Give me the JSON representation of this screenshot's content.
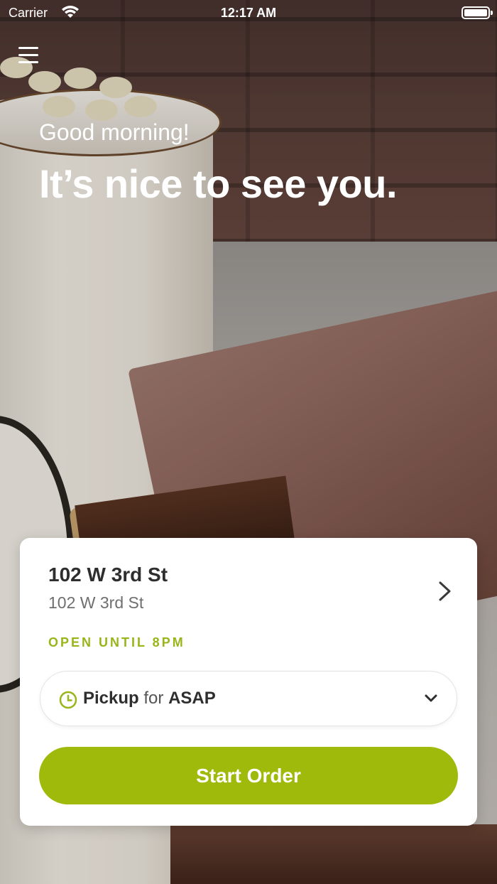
{
  "status_bar": {
    "carrier": "Carrier",
    "time": "12:17 AM"
  },
  "hero": {
    "greeting": "Good morning!",
    "headline": "It’s nice to see you."
  },
  "location_card": {
    "location_name": "102 W 3rd St",
    "location_address": "102 W 3rd St",
    "open_status": "OPEN UNTIL 8PM",
    "pickup": {
      "mode": "Pickup",
      "connector": "for",
      "time": "ASAP"
    },
    "start_order_label": "Start Order"
  },
  "colors": {
    "accent": "#9fba0a",
    "open_status": "#98b51a",
    "card_bg": "#ffffff"
  },
  "icons": {
    "menu": "hamburger-menu-icon",
    "chevron": "chevron-right-icon",
    "clock": "clock-icon",
    "dropdown": "chevron-down-icon"
  }
}
